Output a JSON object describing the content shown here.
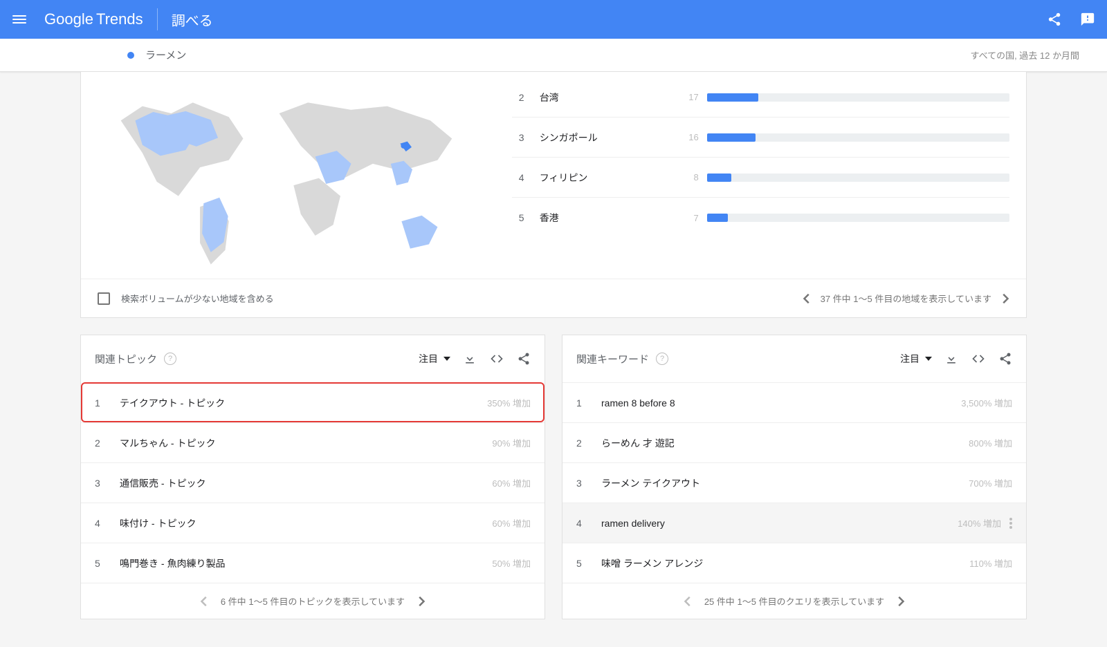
{
  "header": {
    "logo_text": "Google",
    "logo_sub": "Trends",
    "page": "調べる"
  },
  "subheader": {
    "term": "ラーメン",
    "scope": "すべての国, 過去 12 か月間"
  },
  "regions": {
    "checkbox_label": "検索ボリュームが少ない地域を含める",
    "pager_text": "37 件中 1〜5 件目の地域を表示しています",
    "items": [
      {
        "rank": "2",
        "name": "台湾",
        "value": "17",
        "pct": 17
      },
      {
        "rank": "3",
        "name": "シンガポール",
        "value": "16",
        "pct": 16
      },
      {
        "rank": "4",
        "name": "フィリピン",
        "value": "8",
        "pct": 8
      },
      {
        "rank": "5",
        "name": "香港",
        "value": "7",
        "pct": 7
      }
    ]
  },
  "topics": {
    "title": "関連トピック",
    "sort": "注目",
    "pager_text": "6 件中 1〜5 件目のトピックを表示しています",
    "items": [
      {
        "rank": "1",
        "label": "テイクアウト - トピック",
        "value": "350% 増加",
        "highlight": true
      },
      {
        "rank": "2",
        "label": "マルちゃん - トピック",
        "value": "90% 増加"
      },
      {
        "rank": "3",
        "label": "通信販売 - トピック",
        "value": "60% 増加"
      },
      {
        "rank": "4",
        "label": "味付け - トピック",
        "value": "60% 増加"
      },
      {
        "rank": "5",
        "label": "鳴門巻き - 魚肉練り製品",
        "value": "50% 増加"
      }
    ]
  },
  "queries": {
    "title": "関連キーワード",
    "sort": "注目",
    "pager_text": "25 件中 1〜5 件目のクエリを表示しています",
    "items": [
      {
        "rank": "1",
        "label": "ramen 8 before 8",
        "value": "3,500% 増加"
      },
      {
        "rank": "2",
        "label": "らーめん 才 遊記",
        "value": "800% 増加"
      },
      {
        "rank": "3",
        "label": "ラーメン テイクアウト",
        "value": "700% 増加"
      },
      {
        "rank": "4",
        "label": "ramen delivery",
        "value": "140% 増加",
        "hover": true,
        "menu": true
      },
      {
        "rank": "5",
        "label": "味噌 ラーメン アレンジ",
        "value": "110% 増加"
      }
    ]
  }
}
